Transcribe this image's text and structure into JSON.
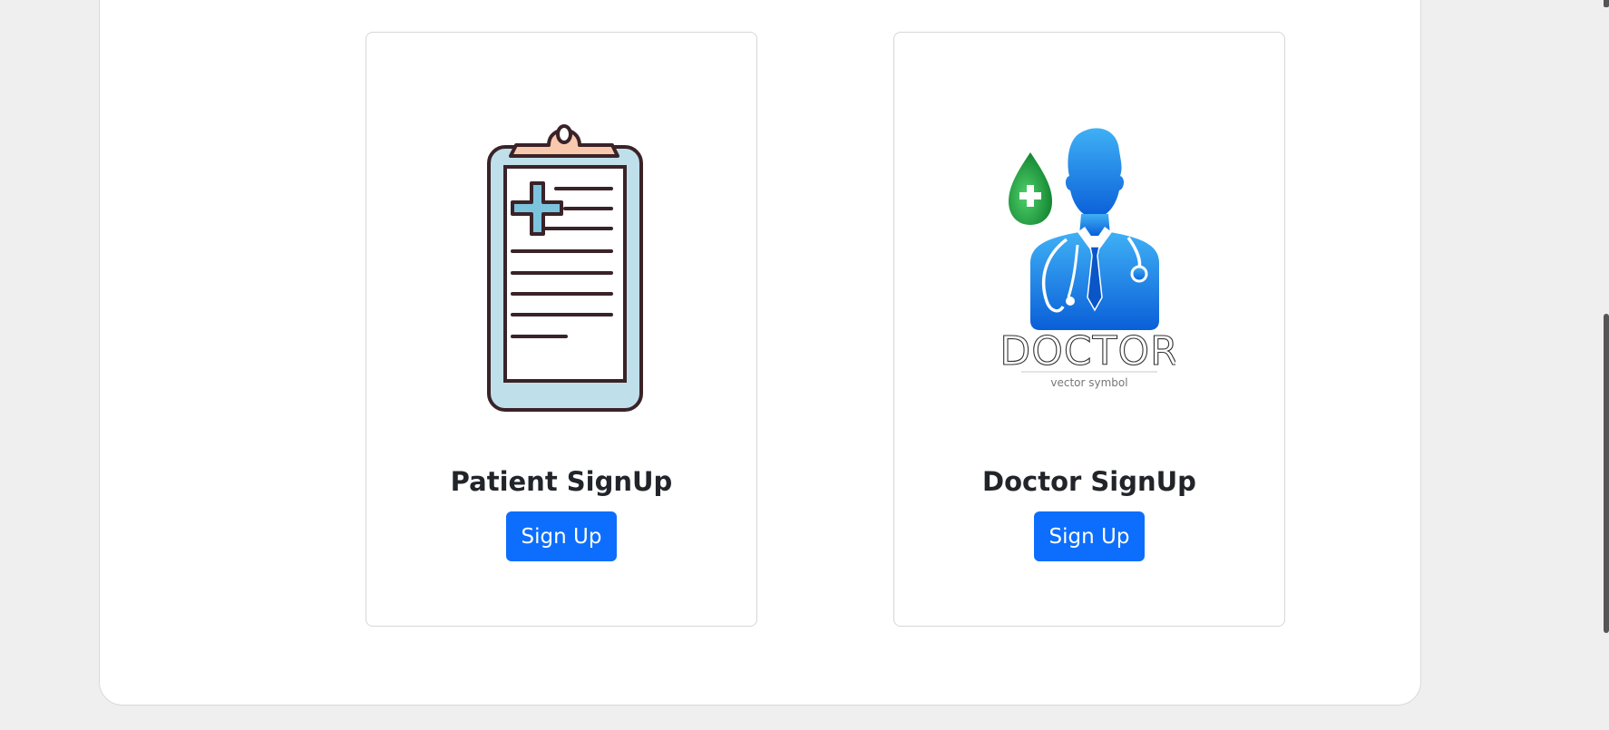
{
  "signup_cards": [
    {
      "title": "Patient SignUp",
      "button_label": "Sign Up",
      "icon": "clipboard-medical-icon"
    },
    {
      "title": "Doctor SignUp",
      "button_label": "Sign Up",
      "icon": "doctor-icon",
      "logo_text": "DOCTOR",
      "logo_subtext": "vector symbol"
    }
  ],
  "colors": {
    "primary_button": "#0d6efd",
    "page_background": "#efefef",
    "panel_background": "#ffffff",
    "clipboard_fill": "#bfe0ea",
    "clipboard_clip": "#f8c9ad",
    "doctor_blue": "#1e88f0",
    "drop_green": "#1a9e3a"
  }
}
